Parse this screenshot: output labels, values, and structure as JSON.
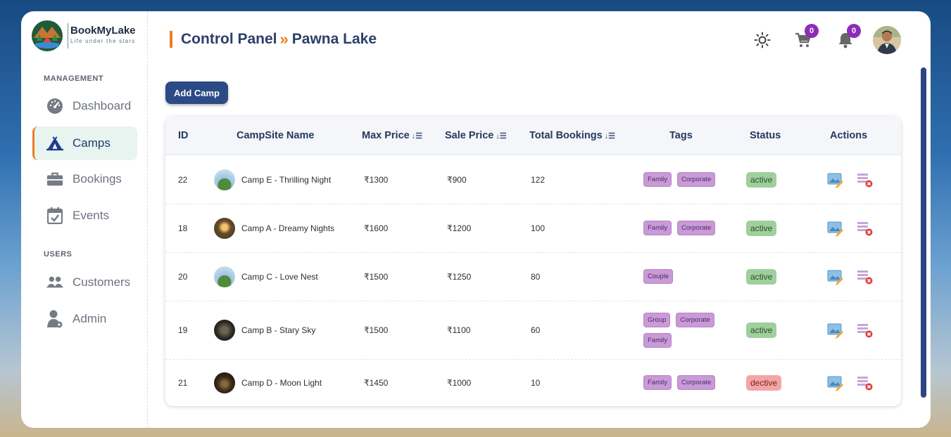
{
  "brand": {
    "name": "BookMyLake",
    "tagline": "Life under the stars"
  },
  "sidebar": {
    "sections": [
      {
        "label": "MANAGEMENT"
      },
      {
        "label": "USERS"
      }
    ],
    "items": [
      {
        "label": "Dashboard",
        "icon": "gauge-icon",
        "active": false
      },
      {
        "label": "Camps",
        "icon": "tent-icon",
        "active": true
      },
      {
        "label": "Bookings",
        "icon": "briefcase-icon",
        "active": false
      },
      {
        "label": "Events",
        "icon": "calendar-check-icon",
        "active": false
      },
      {
        "label": "Customers",
        "icon": "users-icon",
        "active": false
      },
      {
        "label": "Admin",
        "icon": "admin-icon",
        "active": false
      }
    ]
  },
  "header": {
    "crumb_root": "Control Panel",
    "crumb_separator": "»",
    "crumb_current": "Pawna Lake",
    "cart_count": "0",
    "notification_count": "0"
  },
  "toolbar": {
    "add_label": "Add Camp"
  },
  "table": {
    "columns": [
      "ID",
      "CampSite Name",
      "Max Price",
      "Sale Price",
      "Total Bookings",
      "Tags",
      "Status",
      "Actions"
    ],
    "rows": [
      {
        "id": "22",
        "name": "Camp E - Thrilling Night",
        "max_price": "₹1300",
        "sale_price": "₹900",
        "bookings": "122",
        "tags": [
          "Family",
          "Corporate"
        ],
        "status": "active"
      },
      {
        "id": "18",
        "name": "Camp A - Dreamy Nights",
        "max_price": "₹1600",
        "sale_price": "₹1200",
        "bookings": "100",
        "tags": [
          "Family",
          "Corporate"
        ],
        "status": "active"
      },
      {
        "id": "20",
        "name": "Camp C - Love Nest",
        "max_price": "₹1500",
        "sale_price": "₹1250",
        "bookings": "80",
        "tags": [
          "Couple"
        ],
        "status": "active"
      },
      {
        "id": "19",
        "name": "Camp B - Stary Sky",
        "max_price": "₹1500",
        "sale_price": "₹1100",
        "bookings": "60",
        "tags": [
          "Group",
          "Corporate",
          "Family"
        ],
        "status": "active"
      },
      {
        "id": "21",
        "name": "Camp D - Moon Light",
        "max_price": "₹1450",
        "sale_price": "₹1000",
        "bookings": "10",
        "tags": [
          "Family",
          "Corporate"
        ],
        "status": "dective"
      }
    ]
  },
  "colors": {
    "accent": "#f07c1e",
    "primary": "#2b4a86",
    "tag_bg": "#c99ad6",
    "badge": "#8e2bb8"
  }
}
